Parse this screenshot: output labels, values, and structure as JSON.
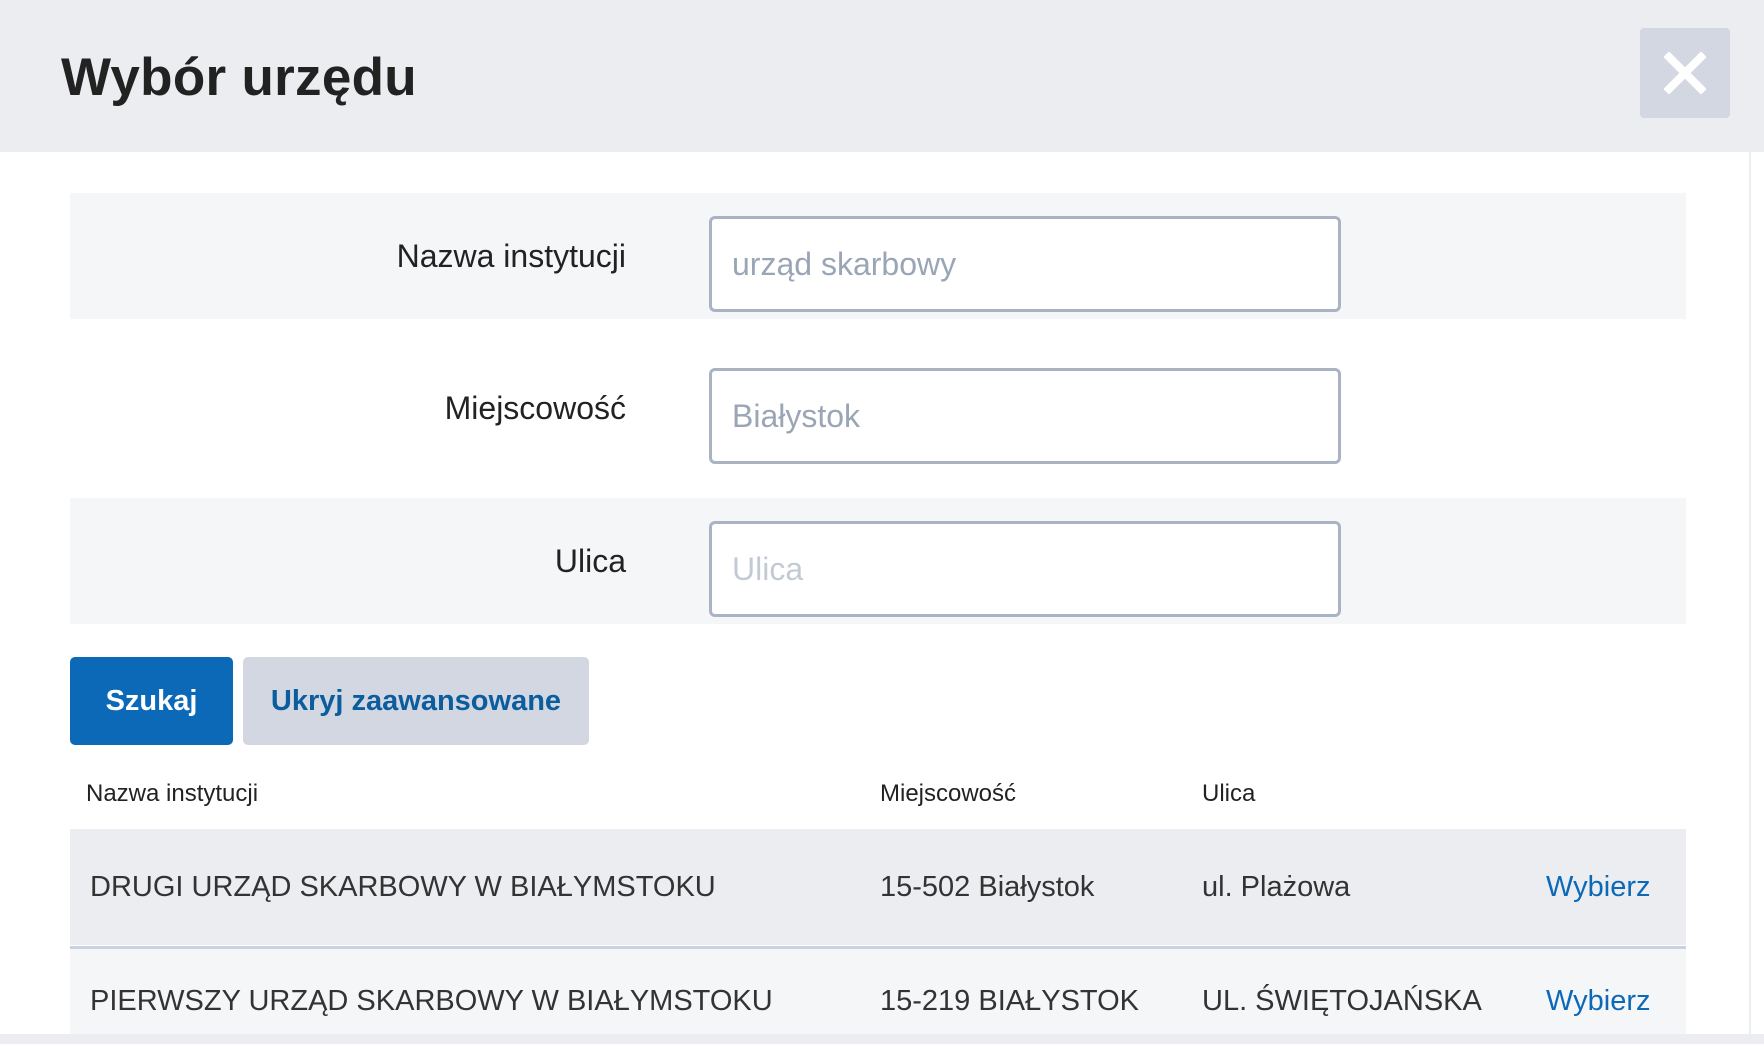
{
  "dialog": {
    "title": "Wybór urzędu",
    "close_icon": "close-icon"
  },
  "form": {
    "institution": {
      "label": "Nazwa instytucji",
      "value": "urząd skarbowy"
    },
    "city": {
      "label": "Miejscowość",
      "value": "Białystok"
    },
    "street": {
      "label": "Ulica",
      "value": "",
      "placeholder": "Ulica"
    }
  },
  "buttons": {
    "search": "Szukaj",
    "hide_advanced": "Ukryj zaawansowane"
  },
  "table": {
    "headers": [
      "Nazwa instytucji",
      "Miejscowość",
      "Ulica"
    ],
    "rows": [
      {
        "name": "DRUGI URZĄD SKARBOWY W BIAŁYMSTOKU",
        "city": "15-502 Białystok",
        "street": "ul. Plażowa",
        "action": "Wybierz"
      },
      {
        "name": "PIERWSZY URZĄD SKARBOWY W BIAŁYMSTOKU",
        "city": "15-219 BIAŁYSTOK",
        "street": "UL. ŚWIĘTOJAŃSKA",
        "action": "Wybierz"
      }
    ]
  },
  "colors": {
    "primary": "#0b69b7",
    "header_bg": "#ebedf1",
    "secondary_button": "#d3d7e2"
  }
}
